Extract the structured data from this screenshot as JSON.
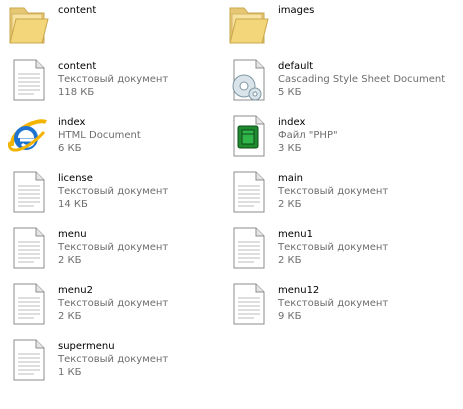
{
  "items": [
    {
      "name": "content",
      "type": "",
      "size": "",
      "icon": "folder-icon"
    },
    {
      "name": "images",
      "type": "",
      "size": "",
      "icon": "folder-icon"
    },
    {
      "name": "content",
      "type": "Текстовый документ",
      "size": "118 КБ",
      "icon": "text-document-icon"
    },
    {
      "name": "default",
      "type": "Cascading Style Sheet Document",
      "size": "5 КБ",
      "icon": "css-document-icon"
    },
    {
      "name": "index",
      "type": "HTML Document",
      "size": "6 КБ",
      "icon": "internet-explorer-icon"
    },
    {
      "name": "index",
      "type": "Файл \"PHP\"",
      "size": "3 КБ",
      "icon": "php-document-icon"
    },
    {
      "name": "license",
      "type": "Текстовый документ",
      "size": "14 КБ",
      "icon": "text-document-icon"
    },
    {
      "name": "main",
      "type": "Текстовый документ",
      "size": "2 КБ",
      "icon": "text-document-icon"
    },
    {
      "name": "menu",
      "type": "Текстовый документ",
      "size": "2 КБ",
      "icon": "text-document-icon"
    },
    {
      "name": "menu1",
      "type": "Текстовый документ",
      "size": "2 КБ",
      "icon": "text-document-icon"
    },
    {
      "name": "menu2",
      "type": "Текстовый документ",
      "size": "2 КБ",
      "icon": "text-document-icon"
    },
    {
      "name": "menu12",
      "type": "Текстовый документ",
      "size": "9 КБ",
      "icon": "text-document-icon"
    },
    {
      "name": "supermenu",
      "type": "Текстовый документ",
      "size": "1 КБ",
      "icon": "text-document-icon"
    }
  ]
}
